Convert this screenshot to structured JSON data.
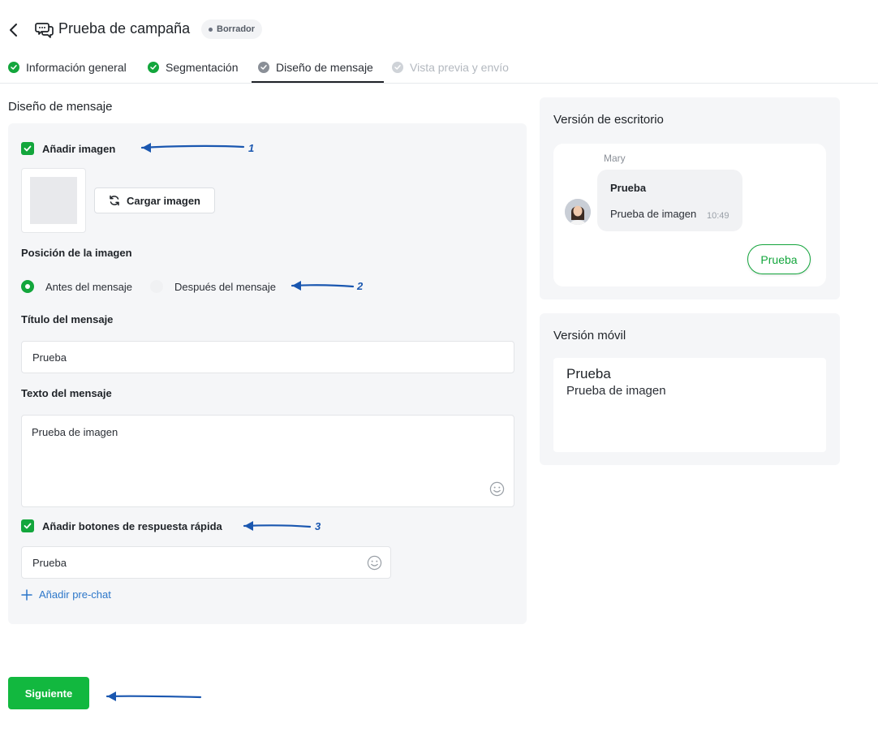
{
  "header": {
    "title": "Prueba de campaña",
    "status_badge": "Borrador"
  },
  "steps": [
    {
      "label": "Información general",
      "state": "done"
    },
    {
      "label": "Segmentación",
      "state": "done"
    },
    {
      "label": "Diseño de mensaje",
      "state": "active"
    },
    {
      "label": "Vista previa y envío",
      "state": "disabled"
    }
  ],
  "section_title": "Diseño de mensaje",
  "form": {
    "add_image_label": "Añadir imagen",
    "add_image_checked": true,
    "upload_button": "Cargar imagen",
    "image_position_label": "Posición de la imagen",
    "position_options": [
      {
        "label": "Antes del mensaje",
        "selected": true
      },
      {
        "label": "Después del mensaje",
        "selected": false
      }
    ],
    "message_title_label": "Título del mensaje",
    "message_title_value": "Prueba",
    "message_text_label": "Texto del mensaje",
    "message_text_value": "Prueba de imagen",
    "quick_replies_label": "Añadir botones de respuesta rápida",
    "quick_replies_checked": true,
    "quick_reply_value": "Prueba",
    "add_prechat": "Añadir pre-chat"
  },
  "next_button": "Siguiente",
  "annotations": [
    "1",
    "2",
    "3"
  ],
  "desktop_preview": {
    "title": "Versión de escritorio",
    "sender": "Mary",
    "bubble_title": "Prueba",
    "bubble_text": "Prueba de imagen",
    "time": "10:49",
    "quick_reply": "Prueba"
  },
  "mobile_preview": {
    "title": "Versión móvil",
    "message_title": "Prueba",
    "message_text": "Prueba de imagen"
  },
  "colors": {
    "accent_green": "#13a63c",
    "primary_button": "#12b83f",
    "link_blue": "#2d77c9",
    "annotation_blue": "#1a57b0"
  }
}
